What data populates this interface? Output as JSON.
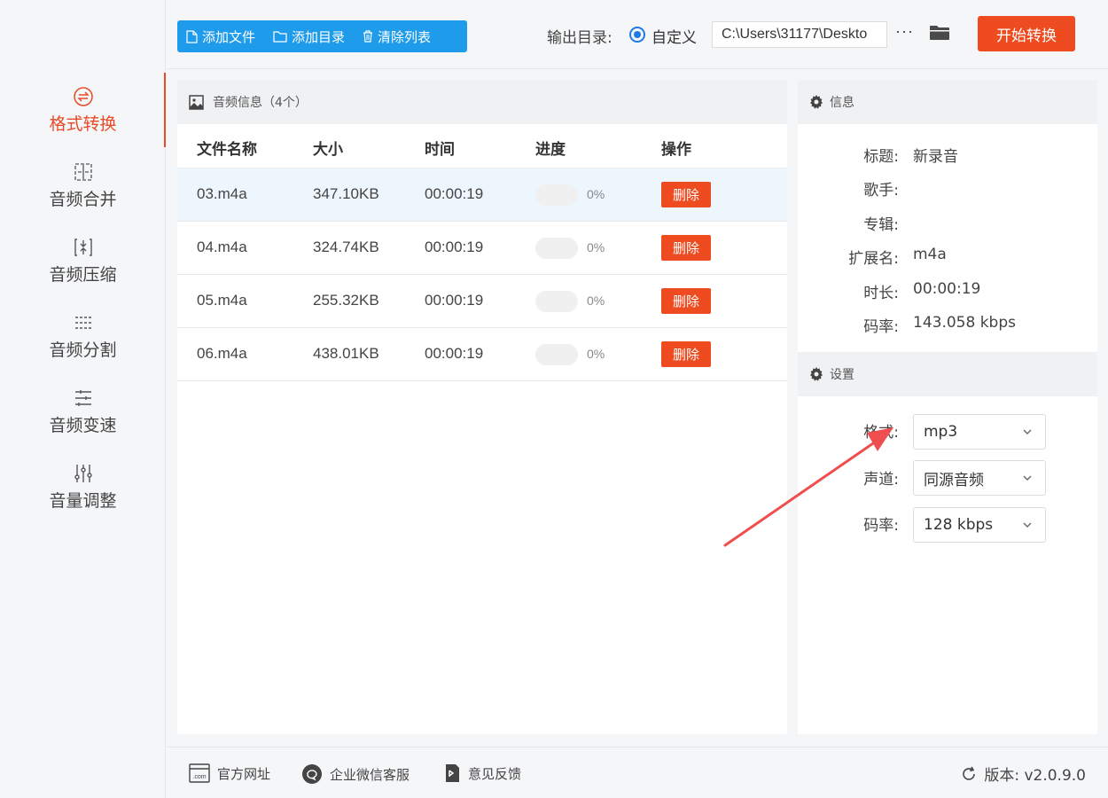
{
  "sidebar": {
    "items": [
      {
        "label": "格式转换",
        "icon": "format-convert-icon"
      },
      {
        "label": "音频合并",
        "icon": "merge-icon"
      },
      {
        "label": "音频压缩",
        "icon": "compress-icon"
      },
      {
        "label": "音频分割",
        "icon": "split-icon"
      },
      {
        "label": "音频变速",
        "icon": "speed-icon"
      },
      {
        "label": "音量调整",
        "icon": "volume-adjust-icon"
      }
    ]
  },
  "toolbar": {
    "add_file": "添加文件",
    "add_dir": "添加目录",
    "clear_list": "清除列表",
    "output_label": "输出目录:",
    "radio_label": "自定义",
    "path_value": "C:\\Users\\31177\\Deskto",
    "more": "···",
    "start": "开始转换",
    "accent": "#ee4b20",
    "blue": "#1e9bea"
  },
  "list": {
    "title": "音频信息（4个）",
    "columns": [
      "文件名称",
      "大小",
      "时间",
      "进度",
      "操作"
    ],
    "rows": [
      {
        "name": "03.m4a",
        "size": "347.10KB",
        "time": "00:00:19",
        "progress": "0%",
        "action": "删除"
      },
      {
        "name": "04.m4a",
        "size": "324.74KB",
        "time": "00:00:19",
        "progress": "0%",
        "action": "删除"
      },
      {
        "name": "05.m4a",
        "size": "255.32KB",
        "time": "00:00:19",
        "progress": "0%",
        "action": "删除"
      },
      {
        "name": "06.m4a",
        "size": "438.01KB",
        "time": "00:00:19",
        "progress": "0%",
        "action": "删除"
      }
    ]
  },
  "info": {
    "title": "信息",
    "fields": [
      {
        "key": "标题:",
        "value": "新录音"
      },
      {
        "key": "歌手:",
        "value": ""
      },
      {
        "key": "专辑:",
        "value": ""
      },
      {
        "key": "扩展名:",
        "value": "m4a"
      },
      {
        "key": "时长:",
        "value": "00:00:19"
      },
      {
        "key": "码率:",
        "value": "143.058 kbps"
      }
    ]
  },
  "settings": {
    "title": "设置",
    "fields": [
      {
        "key": "格式:",
        "value": "mp3"
      },
      {
        "key": "声道:",
        "value": "同源音频"
      },
      {
        "key": "码率:",
        "value": "128 kbps"
      }
    ]
  },
  "footer": {
    "website": "官方网址",
    "wechat": "企业微信客服",
    "feedback": "意见反馈",
    "version": "版本: v2.0.9.0"
  }
}
